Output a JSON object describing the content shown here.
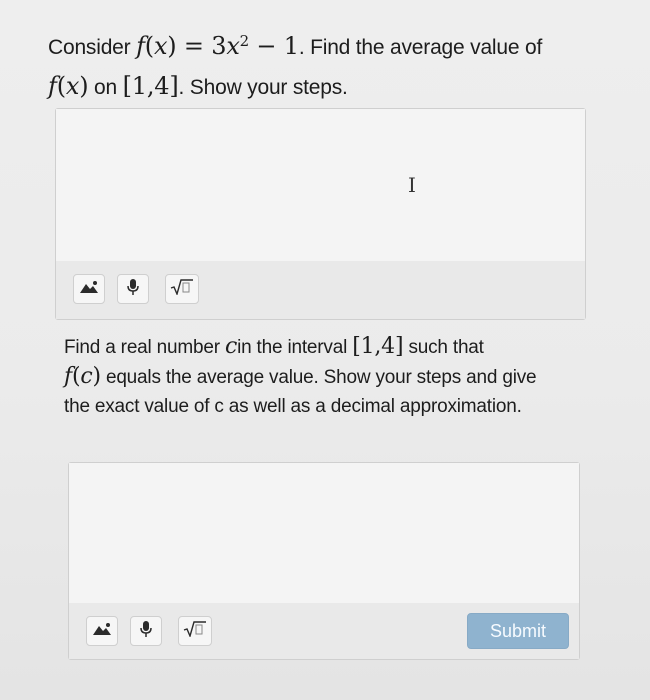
{
  "question1": {
    "prefix": "Consider",
    "f_italic": "f",
    "lparen": "(",
    "x_italic": "x",
    "rparen": ")",
    "equals": " = 3",
    "x2_italic": "x",
    "exponent": "2",
    "minus_one": " − 1",
    "after_func": ". Find the average value of",
    "f2_italic": "f",
    "x3_italic": "x",
    "on_word": "on",
    "interval": "[1,4]",
    "after_interval": ". Show your steps."
  },
  "answer_box_1": {
    "toolbar": {
      "image_icon": "image-upload-icon",
      "mic_icon": "microphone-icon",
      "math_icon": "square-root-icon"
    }
  },
  "question2": {
    "line1_prefix": "Find a real number",
    "c_italic": "c",
    "line1_mid": "in the interval",
    "interval": "[1,4]",
    "line1_suffix": "such that",
    "f_italic": "f",
    "c2_italic": "c",
    "line2_rest": "equals the average value. Show your steps and give the exact value of c as well as a decimal approximation."
  },
  "answer_box_2": {
    "toolbar": {
      "image_icon": "image-upload-icon",
      "mic_icon": "microphone-icon",
      "math_icon": "square-root-icon"
    },
    "submit_label": "Submit"
  },
  "colors": {
    "submit_bg": "#8fb3cf",
    "text": "#1d1d1d",
    "box_border": "#cfcfcf"
  }
}
